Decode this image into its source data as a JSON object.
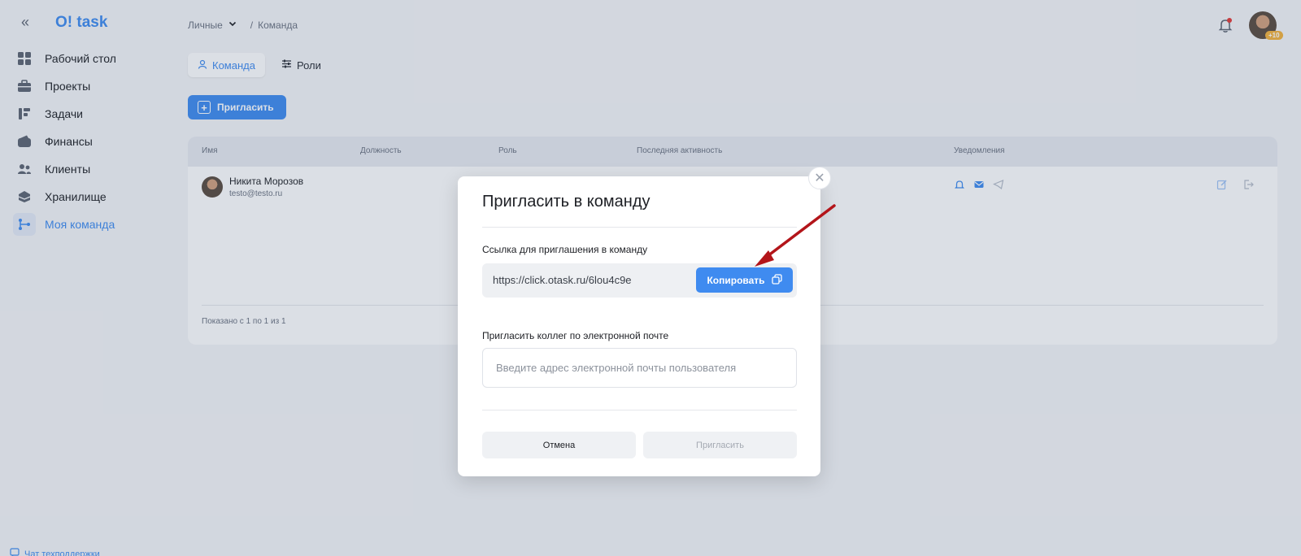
{
  "app": {
    "logo": "O! task"
  },
  "sidebar": {
    "items": [
      {
        "label": "Рабочий стол",
        "icon": "dashboard-icon"
      },
      {
        "label": "Проекты",
        "icon": "briefcase-icon"
      },
      {
        "label": "Задачи",
        "icon": "tasks-icon"
      },
      {
        "label": "Финансы",
        "icon": "wallet-icon"
      },
      {
        "label": "Клиенты",
        "icon": "clients-icon"
      },
      {
        "label": "Хранилище",
        "icon": "storage-icon"
      },
      {
        "label": "Моя команда",
        "icon": "team-icon",
        "active": true
      }
    ],
    "support": "Чат техподдержки"
  },
  "header": {
    "breadcrumb": {
      "workspace": "Личные",
      "separator": "/",
      "page": "Команда"
    },
    "avatar_badge": "+10"
  },
  "tabs": [
    {
      "label": "Команда",
      "icon": "user-icon",
      "active": true
    },
    {
      "label": "Роли",
      "icon": "sliders-icon"
    }
  ],
  "toolbar": {
    "invite_label": "Пригласить"
  },
  "table": {
    "columns": [
      "Имя",
      "Должность",
      "Роль",
      "Последняя активность",
      "Уведомления"
    ],
    "rows": [
      {
        "name": "Никита Морозов",
        "email": "testo@testo.ru"
      }
    ],
    "footer": "Показано с 1 по 1 из 1"
  },
  "modal": {
    "title": "Пригласить в команду",
    "link_label": "Ссылка для приглашения в команду",
    "link": "https://click.otask.ru/6lou4c9e",
    "copy_label": "Копировать",
    "email_label": "Пригласить коллег по электронной почте",
    "email_placeholder": "Введите адрес электронной почты пользователя",
    "cancel_label": "Отмена",
    "invite_label": "Пригласить"
  },
  "colors": {
    "accent": "#3f8bf0",
    "background": "#f5f6f8",
    "annotation_arrow": "#b3151a"
  }
}
